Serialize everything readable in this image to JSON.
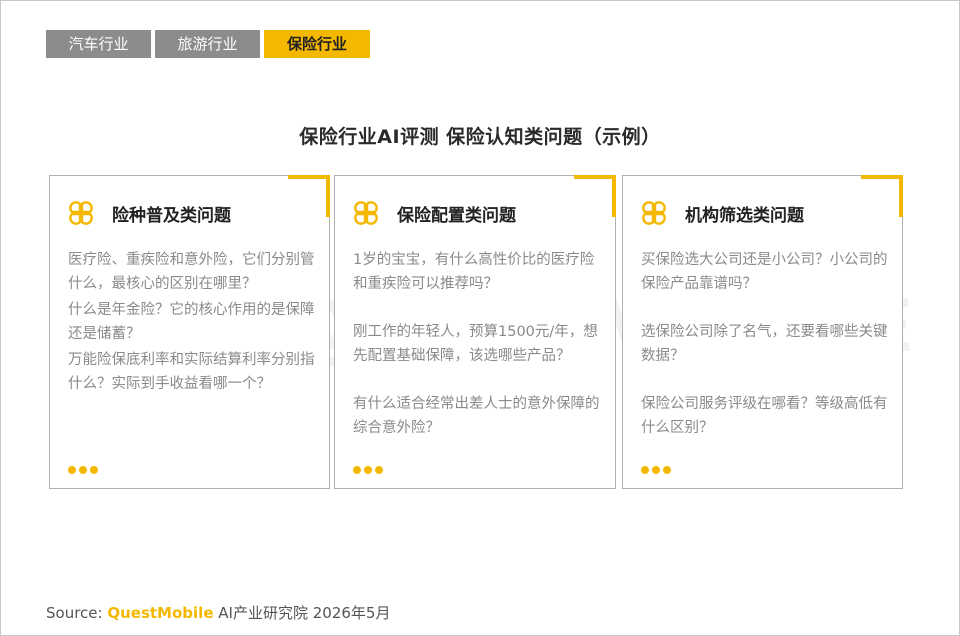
{
  "tabs": [
    {
      "label": "汽车行业",
      "active": false
    },
    {
      "label": "旅游行业",
      "active": false
    },
    {
      "label": "保险行业",
      "active": true
    }
  ],
  "page_title": "保险行业AI评测  保险认知类问题（示例）",
  "watermark": "QUEST MOBILE",
  "cards": [
    {
      "title": "险种普及类问题",
      "questions": [
        "医疗险、重疾险和意外险，它们分别管什么，最核心的区别在哪里？",
        "什么是年金险？它的核心作用的是保障还是储蓄？",
        "万能险保底利率和实际结算利率分别指什么？实际到手收益看哪一个？"
      ]
    },
    {
      "title": "保险配置类问题",
      "questions": [
        "1岁的宝宝，有什么高性价比的医疗险和重疾险可以推荐吗？",
        "刚工作的年轻人，预算1500元/年，想先配置基础保障，该选哪些产品？",
        "有什么适合经常出差人士的意外保障的综合意外险？"
      ]
    },
    {
      "title": "机构筛选类问题",
      "questions": [
        "买保险选大公司还是小公司？小公司的保险产品靠谱吗？",
        "选保险公司除了名气，还要看哪些关键数据？",
        "保险公司服务评级在哪看？等级高低有什么区别？"
      ]
    }
  ],
  "source": {
    "prefix": "Source:",
    "brand": "QuestMobile",
    "suffix": "AI产业研究院 2026年5月"
  },
  "colors": {
    "accent": "#f5b800",
    "tab_inactive": "#8c8c8c",
    "question_text": "#8a8a8a",
    "border": "#b0b0b0"
  },
  "icons": {
    "card_icon": "four-leaf-icon",
    "more": "more-dots-icon"
  }
}
